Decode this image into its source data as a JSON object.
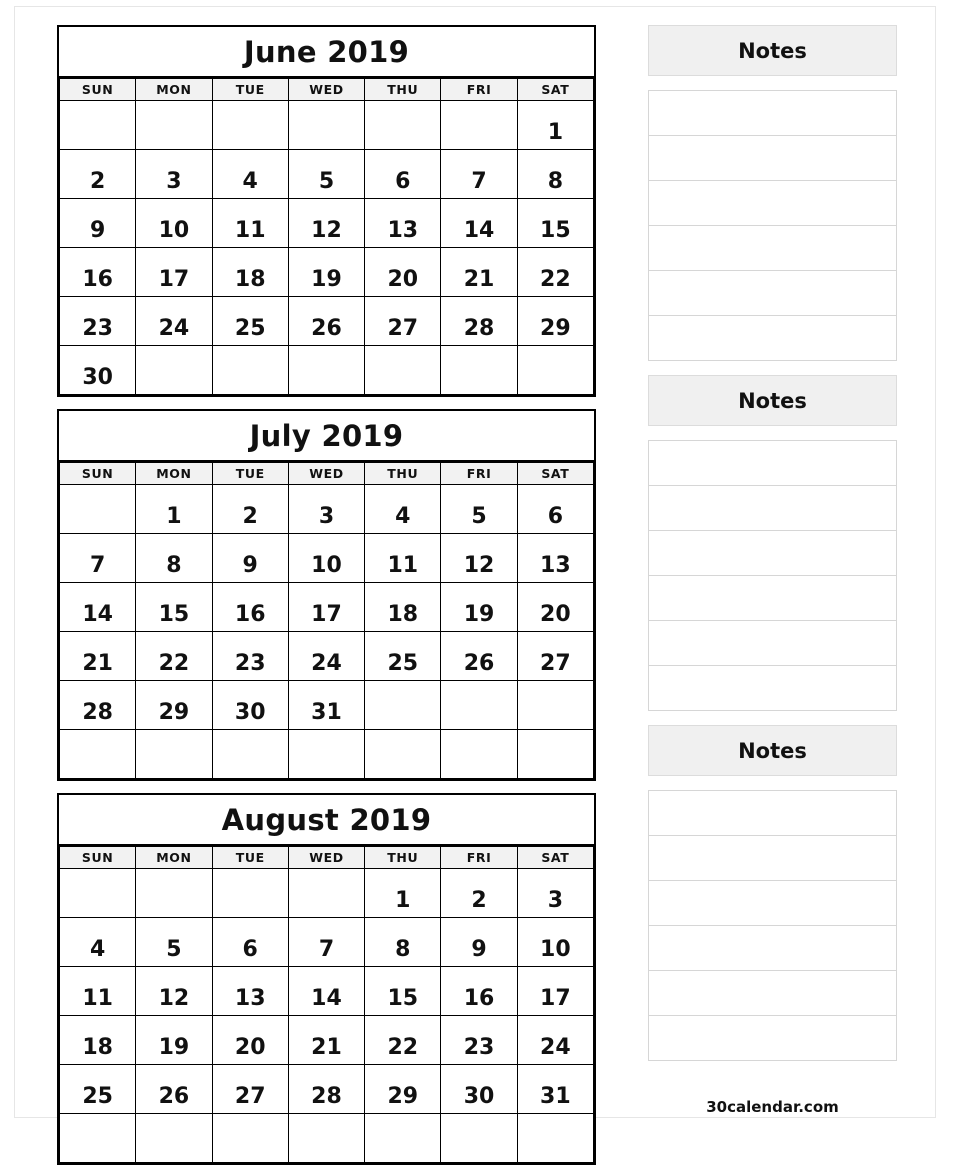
{
  "page": {
    "footer_text": "30calendar.com",
    "colors": {
      "grid_border": "#000000",
      "weekday_band": "#f2f2f2",
      "notes_header_bg": "#f0f0f0",
      "notes_line_border": "#d6d6d6",
      "text": "#111111"
    }
  },
  "weekday_headers": [
    "SUN",
    "MON",
    "TUE",
    "WED",
    "THU",
    "FRI",
    "SAT"
  ],
  "months": [
    {
      "title": "June 2019",
      "weeks": [
        [
          "",
          "",
          "",
          "",
          "",
          "",
          "1"
        ],
        [
          "2",
          "3",
          "4",
          "5",
          "6",
          "7",
          "8"
        ],
        [
          "9",
          "10",
          "11",
          "12",
          "13",
          "14",
          "15"
        ],
        [
          "16",
          "17",
          "18",
          "19",
          "20",
          "21",
          "22"
        ],
        [
          "23",
          "24",
          "25",
          "26",
          "27",
          "28",
          "29"
        ],
        [
          "30",
          "",
          "",
          "",
          "",
          "",
          ""
        ]
      ]
    },
    {
      "title": "July 2019",
      "weeks": [
        [
          "",
          "1",
          "2",
          "3",
          "4",
          "5",
          "6"
        ],
        [
          "7",
          "8",
          "9",
          "10",
          "11",
          "12",
          "13"
        ],
        [
          "14",
          "15",
          "16",
          "17",
          "18",
          "19",
          "20"
        ],
        [
          "21",
          "22",
          "23",
          "24",
          "25",
          "26",
          "27"
        ],
        [
          "28",
          "29",
          "30",
          "31",
          "",
          "",
          ""
        ],
        [
          "",
          "",
          "",
          "",
          "",
          "",
          ""
        ]
      ]
    },
    {
      "title": "August 2019",
      "weeks": [
        [
          "",
          "",
          "",
          "",
          "1",
          "2",
          "3"
        ],
        [
          "4",
          "5",
          "6",
          "7",
          "8",
          "9",
          "10"
        ],
        [
          "11",
          "12",
          "13",
          "14",
          "15",
          "16",
          "17"
        ],
        [
          "18",
          "19",
          "20",
          "21",
          "22",
          "23",
          "24"
        ],
        [
          "25",
          "26",
          "27",
          "28",
          "29",
          "30",
          "31"
        ],
        [
          "",
          "",
          "",
          "",
          "",
          "",
          ""
        ]
      ]
    }
  ],
  "notes_panels": [
    {
      "title": "Notes",
      "line_count": 6
    },
    {
      "title": "Notes",
      "line_count": 6
    },
    {
      "title": "Notes",
      "line_count": 6
    }
  ]
}
